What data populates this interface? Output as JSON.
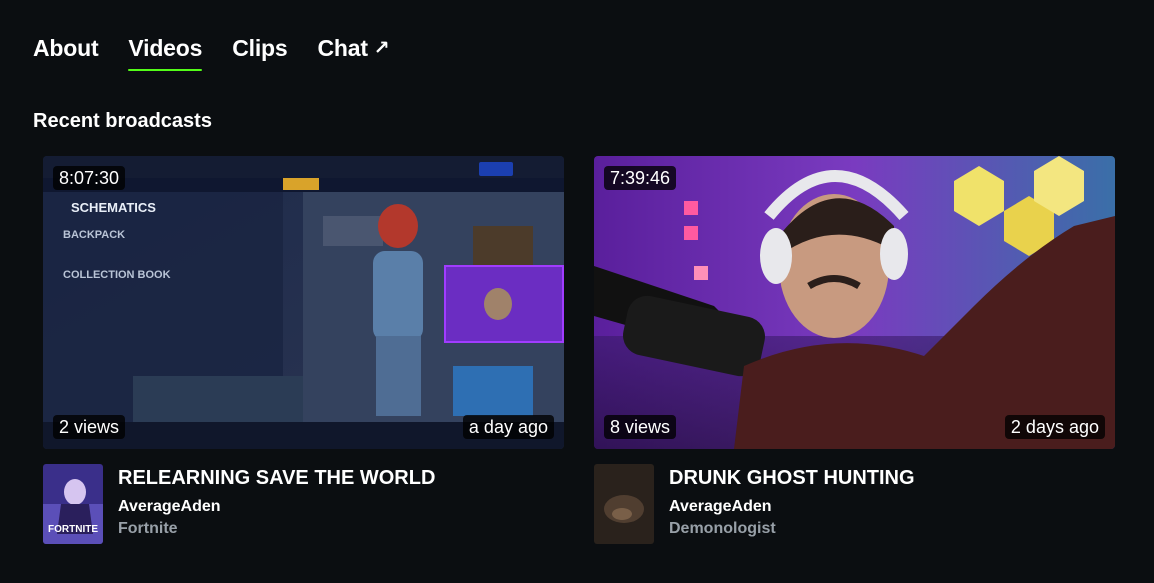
{
  "tabs": [
    {
      "label": "About",
      "active": false
    },
    {
      "label": "Videos",
      "active": true
    },
    {
      "label": "Clips",
      "active": false
    },
    {
      "label": "Chat",
      "active": false,
      "external": true
    }
  ],
  "section": {
    "title": "Recent broadcasts"
  },
  "videos": [
    {
      "duration": "8:07:30",
      "views": "2 views",
      "age": "a day ago",
      "title": "RELEARNING SAVE THE WORLD",
      "channel": "AverageAden",
      "category": "Fortnite",
      "cover_text": "FORTNITE"
    },
    {
      "duration": "7:39:46",
      "views": "8 views",
      "age": "2 days ago",
      "title": "DRUNK GHOST HUNTING",
      "channel": "AverageAden",
      "category": "Demonologist"
    }
  ],
  "colors": {
    "background": "#0b0e11",
    "accent": "#53fc18",
    "muted": "#98a0a8"
  }
}
